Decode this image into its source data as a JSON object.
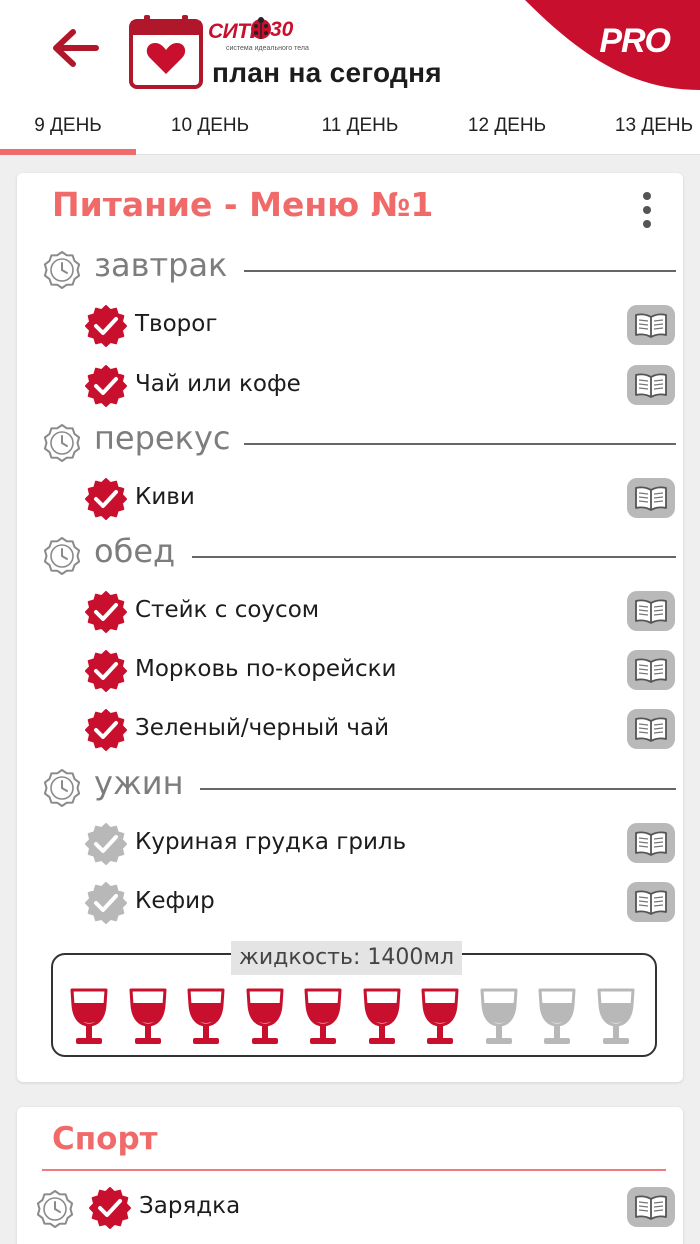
{
  "header": {
    "brand_name": "СИТИ",
    "brand_number": "30",
    "brand_subtitle": "система идеального тела",
    "title": "план на сегодня",
    "pro_badge": "PRO"
  },
  "tabs": [
    {
      "label": "9 ДЕНЬ",
      "active": true
    },
    {
      "label": "10 ДЕНЬ",
      "active": false
    },
    {
      "label": "11 ДЕНЬ",
      "active": false
    },
    {
      "label": "12 ДЕНЬ",
      "active": false
    },
    {
      "label": "13 ДЕНЬ",
      "active": false
    }
  ],
  "nutrition": {
    "title": "Питание - Меню №1",
    "meals": [
      {
        "title": "завтрак",
        "items": [
          {
            "label": "Творог",
            "done": true
          },
          {
            "label": "Чай или кофе",
            "done": true
          }
        ]
      },
      {
        "title": "перекус",
        "items": [
          {
            "label": "Киви",
            "done": true
          }
        ]
      },
      {
        "title": "обед",
        "items": [
          {
            "label": "Стейк с соусом",
            "done": true
          },
          {
            "label": "Морковь по-корейски",
            "done": true
          },
          {
            "label": "Зеленый/черный чай",
            "done": true
          }
        ]
      },
      {
        "title": "ужин",
        "items": [
          {
            "label": "Куриная грудка гриль",
            "done": false
          },
          {
            "label": "Кефир",
            "done": false
          }
        ]
      }
    ],
    "liquid": {
      "label": "жидкость: 1400мл",
      "glasses_total": 10,
      "glasses_filled": 7
    }
  },
  "sport": {
    "title": "Спорт",
    "items": [
      {
        "label": "Зарядка",
        "done": true
      }
    ]
  },
  "colors": {
    "accent": "#f06a6a",
    "check_done": "#c8102e",
    "check_pending": "#b8b8b8",
    "glass_filled": "#c8102e",
    "glass_empty": "#b8b8b8"
  }
}
